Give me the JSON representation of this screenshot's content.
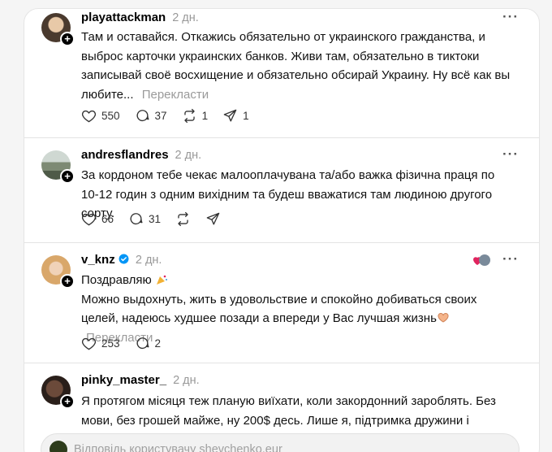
{
  "posts": [
    {
      "username": "playattackman",
      "time": "2 дн.",
      "text": "Там и оставайся. Откажись обязательно от украинского гражданства, и выброс карточки украинских банков. Живи там, обязательно в тиктоки записывай своё восхищение и обязательно обсирай Украину. Ну всё как вы любите...",
      "translate": "Перекласти",
      "likes": "550",
      "replies": "37",
      "reposts": "1",
      "shares": "1"
    },
    {
      "username": "andresflandres",
      "time": "2 дн.",
      "text": "За кордоном тебе чекає малооплачувана та/або важка фізична праця по 10-12 годин з одним вихідним та будеш вважатися там людиною другого сорту.",
      "likes": "66",
      "replies": "31"
    },
    {
      "username": "v_knz",
      "time": "2 дн.",
      "line1": "Поздравляю",
      "line2": "Можно выдохнуть, жить в удовольствие и спокойно добиваться своих целей, надеюсь худшее позади а впереди у Вас лучшая жизнь",
      "translate": "Перекласти",
      "likes": "253",
      "replies": "2"
    },
    {
      "username": "pinky_master_",
      "time": "2 дн.",
      "text": "Я протягом місяця теж планую виїхати, коли закордонний зароблять. Без мови, без грошей майже, ну 200$ десь. Лише я, підтримка дружини і"
    }
  ],
  "reply_placeholder": "Відповідь користувачу shevchenko.eur",
  "icons": [
    "heart-icon",
    "comment-icon",
    "repost-icon",
    "share-icon",
    "more-icon",
    "plus-icon",
    "verified-icon"
  ],
  "colors": {
    "verified": "#0095f6",
    "heart": "#e0245e"
  }
}
